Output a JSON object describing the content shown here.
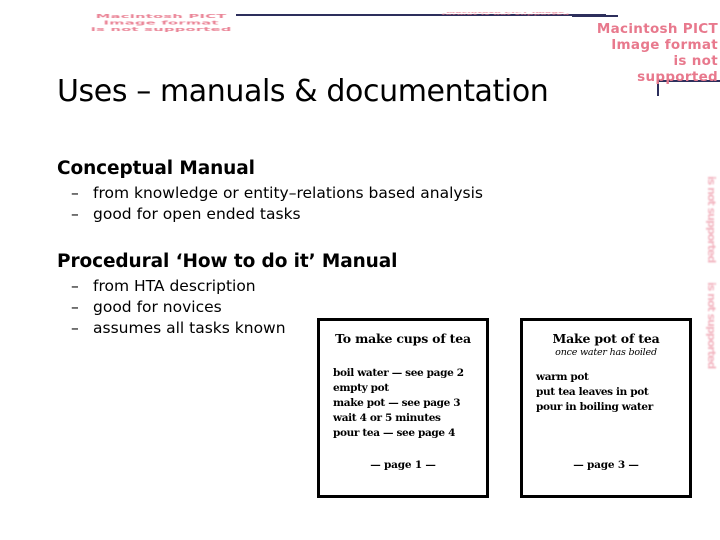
{
  "slide": {
    "title": "Uses – manuals & documentation",
    "background_color": "#ffffff"
  },
  "broken_images": {
    "color": "#e8798d",
    "message": "Macintosh PICT\nImage format\nis not supported",
    "top_left": "Macintosh PICT\nImage format\nis not supported",
    "top_middle": "Macintosh PICT Image format is not supported",
    "top_right": "Macintosh PICT\nImage format\nis not supported",
    "edge_a": "is not supported",
    "edge_b": "is not supported"
  },
  "decor": {
    "rule_color": "#2d2f5c"
  },
  "outline": {
    "groups": [
      {
        "heading": "Conceptual Manual",
        "bullets": [
          {
            "dash": "–",
            "text": "from knowledge or entity–relations based analysis"
          },
          {
            "dash": "–",
            "text": "good for open ended tasks"
          }
        ]
      },
      {
        "heading": "Procedural ‘How to do it’ Manual",
        "bullets": [
          {
            "dash": "–",
            "text": "from HTA description"
          },
          {
            "dash": "–",
            "text": "good for novices"
          },
          {
            "dash": "–",
            "text": "assumes all tasks known"
          }
        ]
      }
    ]
  },
  "page_boxes": [
    {
      "title": "To make cups of tea",
      "subtitle": "",
      "steps": [
        "boil water — see page 2",
        "empty pot",
        "make pot — see page 3",
        "wait 4 or 5 minutes",
        "pour tea — see page 4"
      ],
      "footer": "—  page 1  —"
    },
    {
      "title": "Make pot of tea",
      "subtitle": "once water has boiled",
      "steps": [
        "warm pot",
        "put tea leaves in pot",
        "pour in boiling water"
      ],
      "footer": "—  page 3  —"
    }
  ]
}
